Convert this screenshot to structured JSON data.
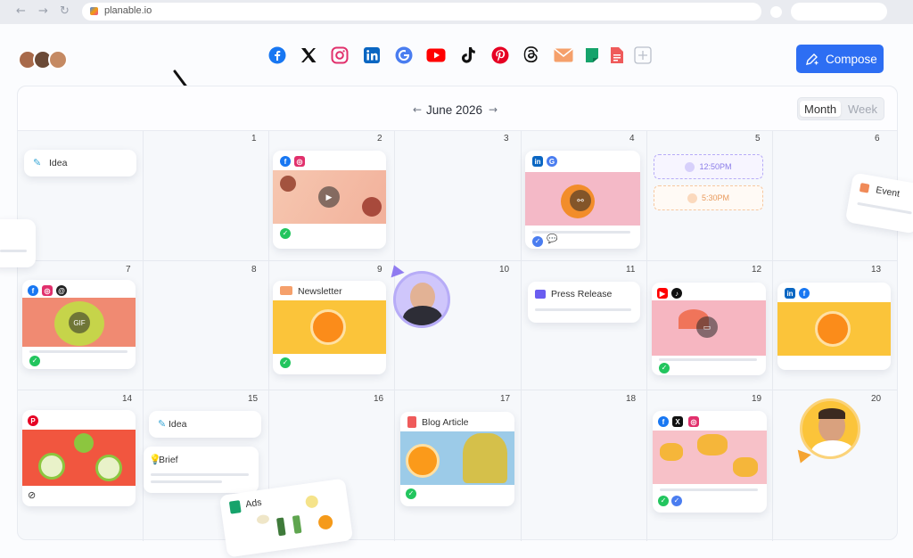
{
  "browser": {
    "url": "planable.io",
    "back": "←",
    "forward": "→",
    "reload": "↻"
  },
  "team": {
    "avatar_colors": [
      "#a86a4a",
      "#6b4a36",
      "#c58a63"
    ]
  },
  "channels": [
    "facebook-icon",
    "x-icon",
    "instagram-icon",
    "linkedin-icon",
    "google-icon",
    "youtube-icon",
    "tiktok-icon",
    "pinterest-icon",
    "threads-icon",
    "email-icon",
    "brief-icon",
    "document-icon",
    "add-channel-icon"
  ],
  "toolbar": {
    "compose_label": "Compose",
    "compose_icon": "pen-icon"
  },
  "calendar": {
    "month_title": "June 2026",
    "prev": "←",
    "next": "→",
    "views": [
      "Month",
      "Week"
    ],
    "days": [
      {
        "n": "1"
      },
      {
        "n": "2"
      },
      {
        "n": "3"
      },
      {
        "n": "4"
      },
      {
        "n": "5"
      },
      {
        "n": "6"
      },
      {
        "n": "7"
      },
      {
        "n": "8"
      },
      {
        "n": "9"
      },
      {
        "n": "10"
      },
      {
        "n": "11"
      },
      {
        "n": "12"
      },
      {
        "n": "13"
      },
      {
        "n": "14"
      },
      {
        "n": "15"
      },
      {
        "n": "16"
      },
      {
        "n": "17"
      },
      {
        "n": "18"
      },
      {
        "n": "19"
      },
      {
        "n": "20"
      }
    ]
  },
  "items": {
    "idea_1": "Idea",
    "slot_1": "12:50PM",
    "slot_2": "5:30PM",
    "event": "Event",
    "newsletter": "Newsletter",
    "press_release": "Press Release",
    "gif": "GIF",
    "idea_2": "Idea",
    "brief": "Brief",
    "blog_article": "Blog Article",
    "ads": "Ads"
  },
  "colors": {
    "accent": "#2d6ef3",
    "success": "#22c55e",
    "purple": "#9b8cf2",
    "orange": "#f5a431"
  }
}
